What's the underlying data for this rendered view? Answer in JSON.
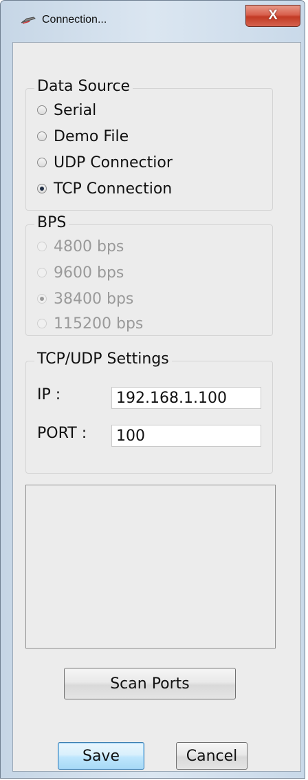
{
  "window": {
    "title": "Connection...",
    "close_label": "X"
  },
  "data_source": {
    "title": "Data Source",
    "options": [
      {
        "label": "Serial",
        "checked": false
      },
      {
        "label": "Demo File",
        "checked": false
      },
      {
        "label": "UDP Connectior",
        "checked": false
      },
      {
        "label": "TCP Connection",
        "checked": true
      }
    ]
  },
  "bps": {
    "title": "BPS",
    "options": [
      {
        "label": "4800 bps",
        "checked": false
      },
      {
        "label": "9600 bps",
        "checked": false
      },
      {
        "label": "38400 bps",
        "checked": true
      },
      {
        "label": "115200 bps",
        "checked": false
      }
    ]
  },
  "tcp_udp": {
    "title": "TCP/UDP Settings",
    "ip_label": "IP :",
    "ip_value": "192.168.1.100",
    "port_label": "PORT :",
    "port_value": "100"
  },
  "buttons": {
    "scan_ports": "Scan Ports",
    "save": "Save",
    "cancel": "Cancel"
  }
}
